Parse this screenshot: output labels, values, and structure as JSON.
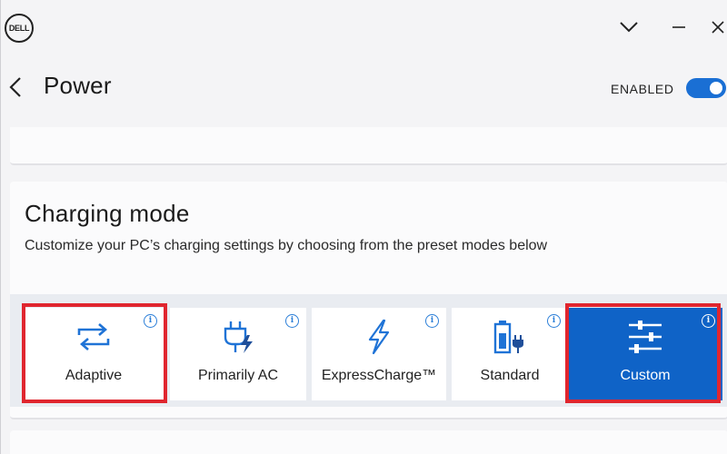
{
  "app": {
    "logo_text": "DELL",
    "colors": {
      "accent": "#0f63c7",
      "toggle": "#1a6fd4",
      "highlight": "#e0262f"
    }
  },
  "titlebar": {
    "icons": [
      "chevron-down-icon",
      "minimize-icon",
      "close-icon"
    ]
  },
  "header": {
    "title": "Power",
    "enabled_label": "ENABLED",
    "toggle_on": true
  },
  "charging": {
    "title": "Charging mode",
    "description": "Customize your PC’s charging settings by choosing from the preset modes below",
    "modes": [
      {
        "label": "Adaptive",
        "icon": "adaptive-sync-icon",
        "selected": false,
        "highlighted": true
      },
      {
        "label": "Primarily AC",
        "icon": "plug-charge-icon",
        "selected": false,
        "highlighted": false
      },
      {
        "label": "ExpressCharge™",
        "icon": "lightning-icon",
        "selected": false,
        "highlighted": false
      },
      {
        "label": "Standard",
        "icon": "battery-plug-icon",
        "selected": false,
        "highlighted": false
      },
      {
        "label": "Custom",
        "icon": "sliders-icon",
        "selected": true,
        "highlighted": true
      }
    ],
    "info_glyph": "i"
  }
}
